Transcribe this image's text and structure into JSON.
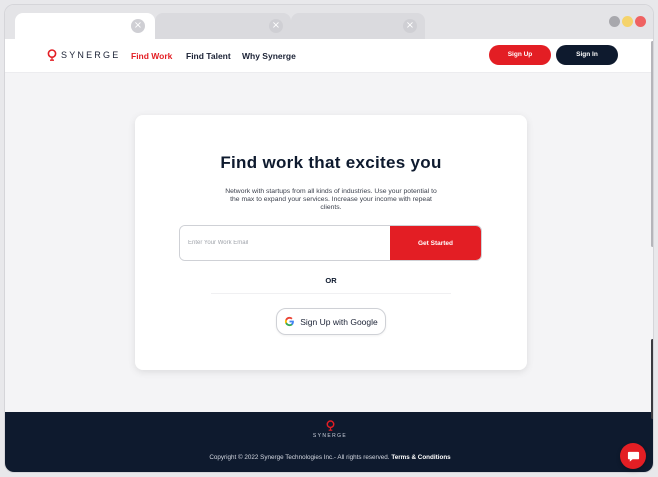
{
  "browser": {
    "tabs": [
      {
        "state": "active",
        "close_glyph": "×"
      },
      {
        "state": "inactive",
        "close_glyph": "×"
      },
      {
        "state": "inactive",
        "close_glyph": "×"
      }
    ],
    "window_controls": [
      "grey",
      "yellow",
      "red"
    ]
  },
  "nav": {
    "logo_text": "SYNERGE",
    "links": [
      {
        "label": "Find Work",
        "active": true
      },
      {
        "label": "Find Talent",
        "active": false
      },
      {
        "label": "Why Synerge",
        "active": false
      }
    ],
    "sign_up_label": "Sign Up",
    "sign_in_label": "Sign In"
  },
  "hero": {
    "heading": "Find work that excites you",
    "subtext": "Network with startups from all kinds of industries. Use your potential to the max to expand your services. Increase your income with repeat clients.",
    "email_placeholder": "Enter Your Work Email",
    "email_value": "",
    "cta_label": "Get Started",
    "or_label": "OR",
    "google_label": "Sign Up with Google"
  },
  "footer": {
    "logo_text": "SYNERGE",
    "copyright": "Copyright © 2022 Synerge Technologies Inc.- All rights reserved.",
    "terms_label": "Terms & Conditions"
  },
  "icons": {
    "logo": "synerge-logo-icon",
    "google": "google-icon",
    "chat": "chat-icon",
    "close": "close-icon"
  },
  "colors": {
    "brand_red": "#e31e24",
    "navy": "#0e1a2e",
    "page_bg": "#f4f4f6"
  }
}
